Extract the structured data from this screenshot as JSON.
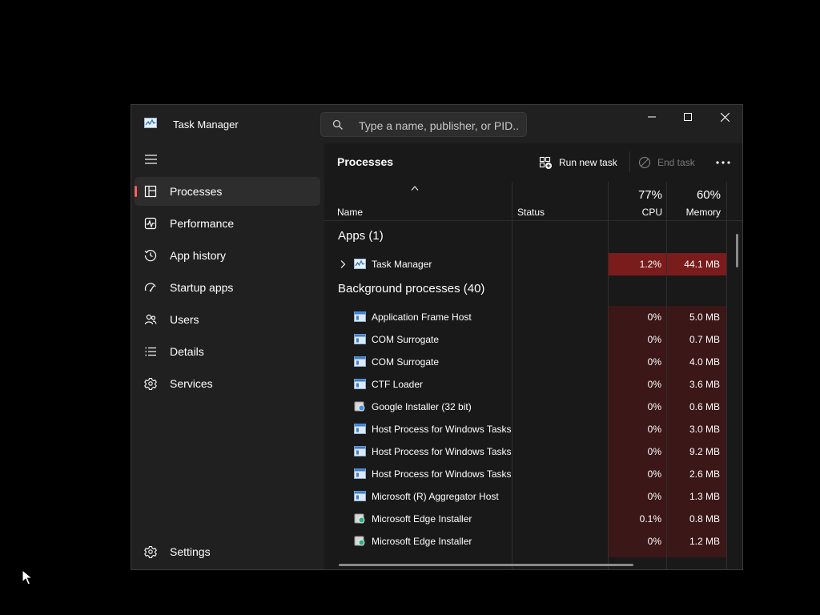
{
  "window": {
    "title": "Task Manager",
    "search_placeholder": "Type a name, publisher, or PID..."
  },
  "sidebar": {
    "items": [
      {
        "label": "Processes",
        "icon": "processes-icon",
        "active": true
      },
      {
        "label": "Performance",
        "icon": "performance-icon"
      },
      {
        "label": "App history",
        "icon": "app-history-icon"
      },
      {
        "label": "Startup apps",
        "icon": "startup-apps-icon"
      },
      {
        "label": "Users",
        "icon": "users-icon"
      },
      {
        "label": "Details",
        "icon": "details-icon"
      },
      {
        "label": "Services",
        "icon": "services-icon"
      }
    ],
    "settings_label": "Settings"
  },
  "toolbar": {
    "title": "Processes",
    "run_new_task": "Run new task",
    "end_task": "End task"
  },
  "columns": {
    "name": "Name",
    "status": "Status",
    "cpu_pct": "77%",
    "cpu": "CPU",
    "memory_pct": "60%",
    "memory": "Memory"
  },
  "groups": {
    "apps": "Apps (1)",
    "background": "Background processes (40)"
  },
  "apps": [
    {
      "name": "Task Manager",
      "cpu": "1.2%",
      "memory": "44.1 MB"
    }
  ],
  "background": [
    {
      "name": "Application Frame Host",
      "cpu": "0%",
      "memory": "5.0 MB"
    },
    {
      "name": "COM Surrogate",
      "cpu": "0%",
      "memory": "0.7 MB"
    },
    {
      "name": "COM Surrogate",
      "cpu": "0%",
      "memory": "4.0 MB"
    },
    {
      "name": "CTF Loader",
      "cpu": "0%",
      "memory": "3.6 MB"
    },
    {
      "name": "Google Installer (32 bit)",
      "cpu": "0%",
      "memory": "0.6 MB"
    },
    {
      "name": "Host Process for Windows Tasks",
      "cpu": "0%",
      "memory": "3.0 MB"
    },
    {
      "name": "Host Process for Windows Tasks",
      "cpu": "0%",
      "memory": "9.2 MB"
    },
    {
      "name": "Host Process for Windows Tasks",
      "cpu": "0%",
      "memory": "2.6 MB"
    },
    {
      "name": "Microsoft (R) Aggregator Host",
      "cpu": "0%",
      "memory": "1.3 MB"
    },
    {
      "name": "Microsoft Edge Installer",
      "cpu": "0.1%",
      "memory": "0.8 MB"
    },
    {
      "name": "Microsoft Edge Installer",
      "cpu": "0%",
      "memory": "1.2 MB"
    }
  ],
  "colors": {
    "accent": "#ff5e5e",
    "heat_high": "#7a1c1c",
    "heat_low": "#3b1717"
  }
}
